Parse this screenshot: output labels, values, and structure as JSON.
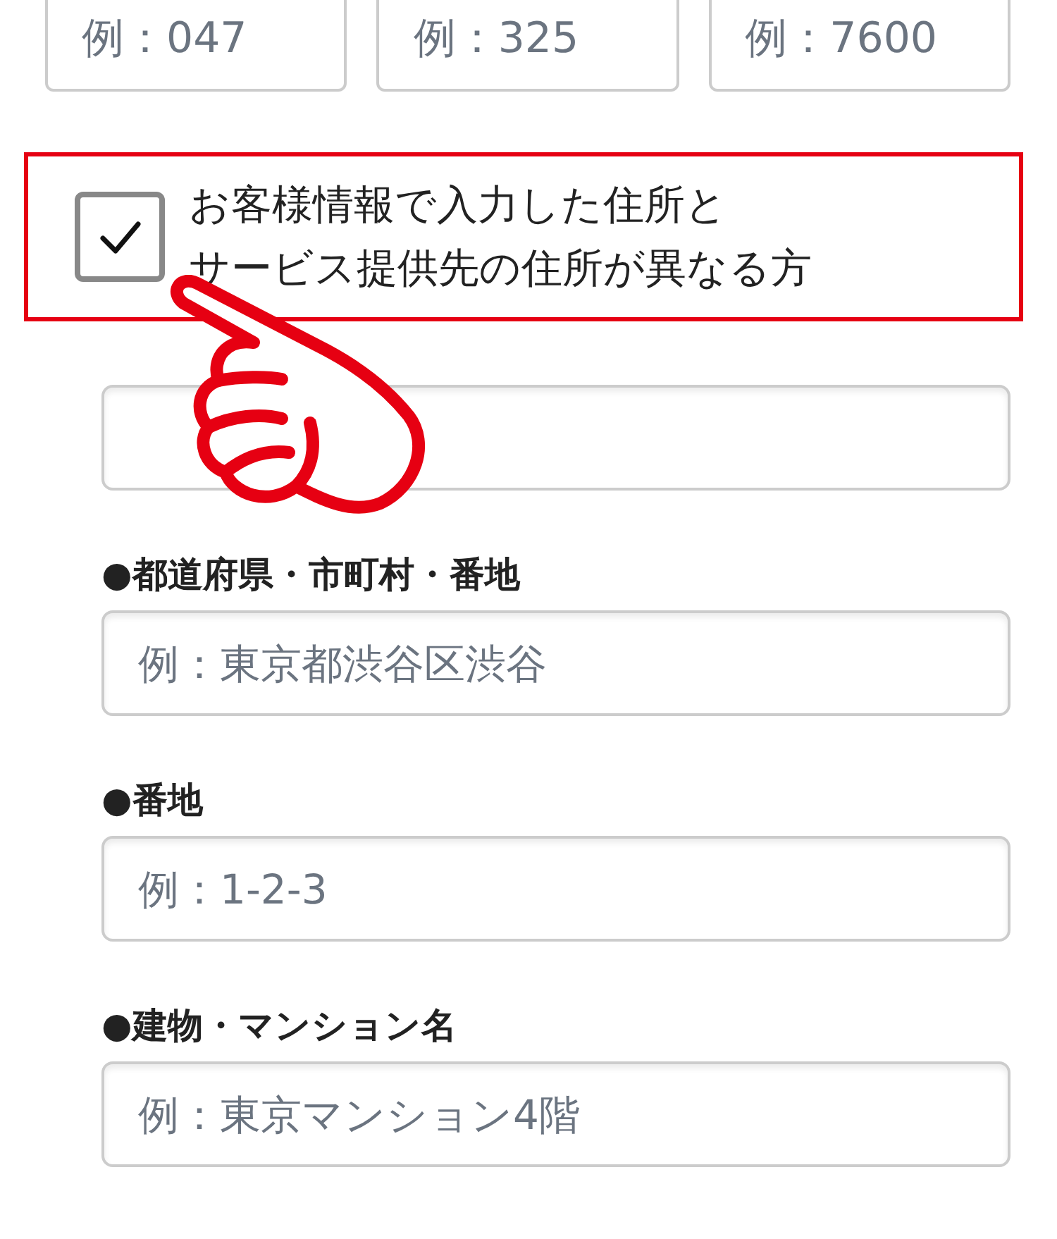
{
  "phone_fields": [
    {
      "placeholder": "例：047"
    },
    {
      "placeholder": "例：325"
    },
    {
      "placeholder": "例：7600"
    }
  ],
  "different_address": {
    "checked": true,
    "label_lines": [
      "お客様情報で入力した住所と",
      "サービス提供先の住所が異なる方"
    ]
  },
  "address_fields": [
    {
      "kind": "unlabeled"
    },
    {
      "kind": "labeled",
      "label": "●都道府県・市町村・番地",
      "placeholder": "例：東京都渋谷区渋谷"
    },
    {
      "kind": "labeled",
      "label": "●番地",
      "placeholder": "例：1-2-3"
    },
    {
      "kind": "labeled",
      "label": "●建物・マンション名",
      "placeholder": "例：東京マンション4階"
    }
  ]
}
